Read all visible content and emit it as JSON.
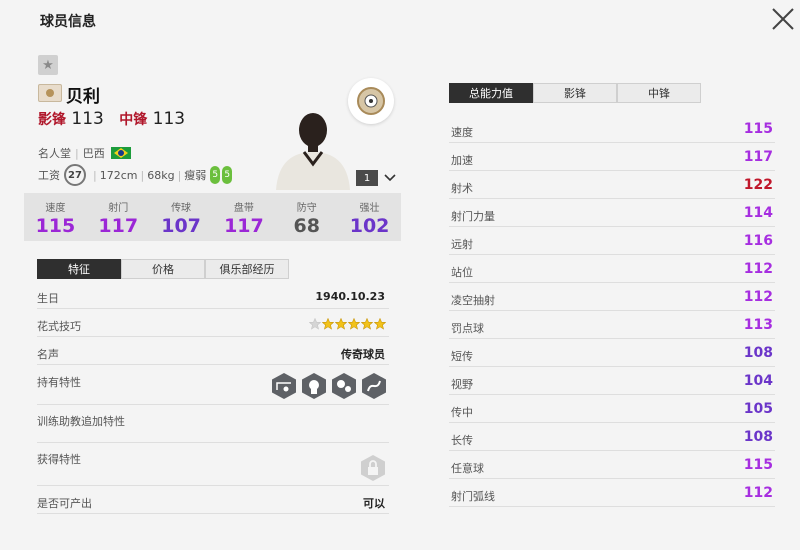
{
  "window": {
    "title": "球员信息"
  },
  "player": {
    "name": "贝利",
    "positions": [
      {
        "label": "影锋",
        "value": "113"
      },
      {
        "label": "中锋",
        "value": "113"
      }
    ],
    "info_line1": {
      "league": "名人堂",
      "country": "巴西"
    },
    "info_line2": {
      "wage_label": "工资",
      "wage": "27",
      "height": "172cm",
      "weight": "68kg",
      "build": "瘦弱",
      "foot_left": "5",
      "foot_right": "5"
    },
    "level": "1"
  },
  "summary_stats": [
    {
      "label": "速度",
      "value": "115",
      "color": "#9b27d6"
    },
    {
      "label": "射门",
      "value": "117",
      "color": "#9b27d6"
    },
    {
      "label": "传球",
      "value": "107",
      "color": "#6b35c9"
    },
    {
      "label": "盘带",
      "value": "117",
      "color": "#9b27d6"
    },
    {
      "label": "防守",
      "value": "68",
      "color": "#555555"
    },
    {
      "label": "强壮",
      "value": "102",
      "color": "#6b35c9"
    }
  ],
  "left_tabs": [
    "特征",
    "价格",
    "俱乐部经历"
  ],
  "feature_rows": {
    "birthday": {
      "label": "生日",
      "value": "1940.10.23"
    },
    "skill": {
      "label": "花式技巧",
      "stars": 5
    },
    "reputation": {
      "label": "名声",
      "value": "传奇球员"
    },
    "traits": {
      "label": "持有特性"
    },
    "coach_traits": {
      "label": "训练助教追加特性"
    },
    "obtain_traits": {
      "label": "获得特性"
    },
    "produce": {
      "label": "是否可产出",
      "value": "可以"
    }
  },
  "right_tabs": [
    "总能力值",
    "影锋",
    "中锋"
  ],
  "attributes": [
    {
      "label": "速度",
      "value": "115",
      "color": "#a62ee0"
    },
    {
      "label": "加速",
      "value": "117",
      "color": "#a62ee0"
    },
    {
      "label": "射术",
      "value": "122",
      "color": "#c0172b"
    },
    {
      "label": "射门力量",
      "value": "114",
      "color": "#a62ee0"
    },
    {
      "label": "远射",
      "value": "116",
      "color": "#a62ee0"
    },
    {
      "label": "站位",
      "value": "112",
      "color": "#a62ee0"
    },
    {
      "label": "凌空抽射",
      "value": "112",
      "color": "#a62ee0"
    },
    {
      "label": "罚点球",
      "value": "113",
      "color": "#a62ee0"
    },
    {
      "label": "短传",
      "value": "108",
      "color": "#6b35c9"
    },
    {
      "label": "视野",
      "value": "104",
      "color": "#6b35c9"
    },
    {
      "label": "传中",
      "value": "105",
      "color": "#6b35c9"
    },
    {
      "label": "长传",
      "value": "108",
      "color": "#6b35c9"
    },
    {
      "label": "任意球",
      "value": "115",
      "color": "#a62ee0"
    },
    {
      "label": "射门弧线",
      "value": "112",
      "color": "#a62ee0"
    }
  ]
}
